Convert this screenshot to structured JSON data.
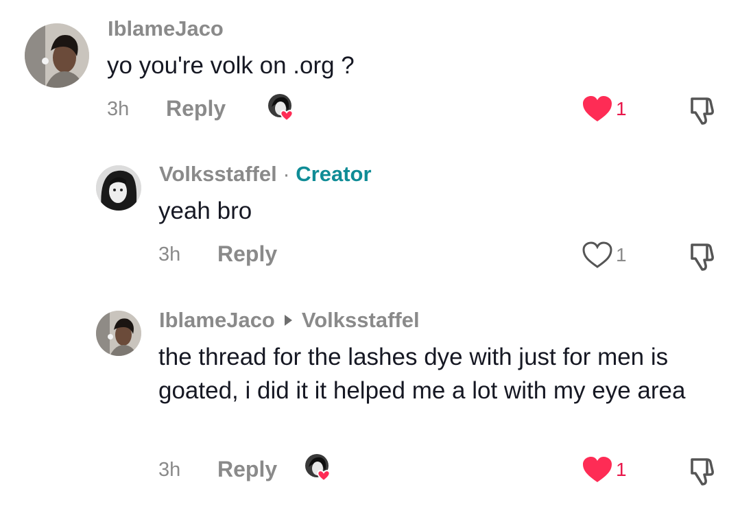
{
  "comments": [
    {
      "username": "IblameJaco",
      "text": "yo you're volk on .org ?",
      "time": "3h",
      "reply_label": "Reply",
      "likes": "1",
      "liked": true,
      "liked_by_creator": true
    },
    {
      "username": "Volksstaffel",
      "separator": "·",
      "badge": "Creator",
      "text": "yeah bro",
      "time": "3h",
      "reply_label": "Reply",
      "likes": "1",
      "liked": false
    },
    {
      "username": "IblameJaco",
      "reply_to": "Volksstaffel",
      "text": "the thread for the lashes dye with just for men is goated, i did it it helped me a lot with my eye area",
      "time": "3h",
      "reply_label": "Reply",
      "likes": "1",
      "liked": true,
      "liked_by_creator": true
    }
  ],
  "colors": {
    "like": "#fe2c55",
    "creator_badge": "#0f8c96",
    "muted_text": "#8a8a8a"
  },
  "icons": {
    "like": "heart-icon",
    "dislike": "thumbs-down-icon",
    "creator_liked": "creator-liked-avatar-icon"
  }
}
